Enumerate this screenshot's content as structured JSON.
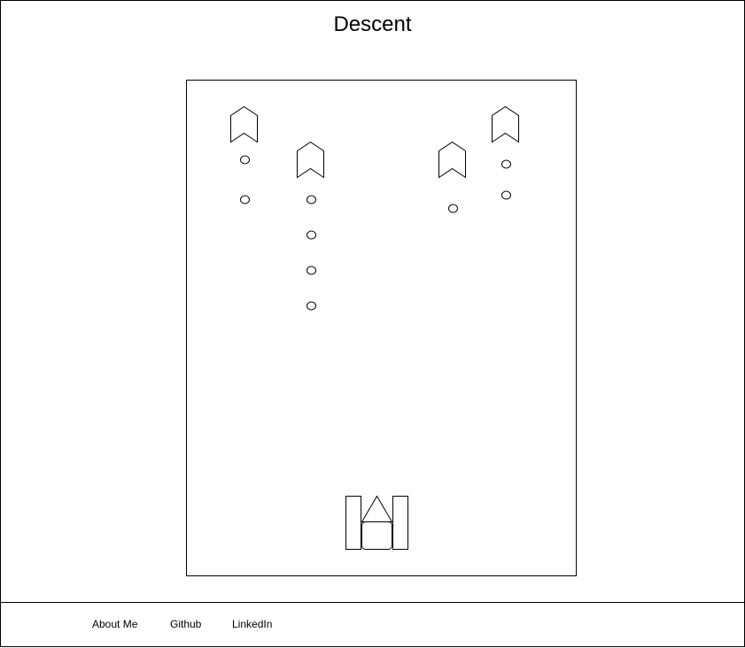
{
  "page": {
    "title": "Descent"
  },
  "game": {
    "enemy_count": 4,
    "enemy_bullet_count": 9,
    "player_count": 1
  },
  "footer": {
    "links": [
      {
        "label": "About Me"
      },
      {
        "label": "Github"
      },
      {
        "label": "LinkedIn"
      }
    ]
  }
}
